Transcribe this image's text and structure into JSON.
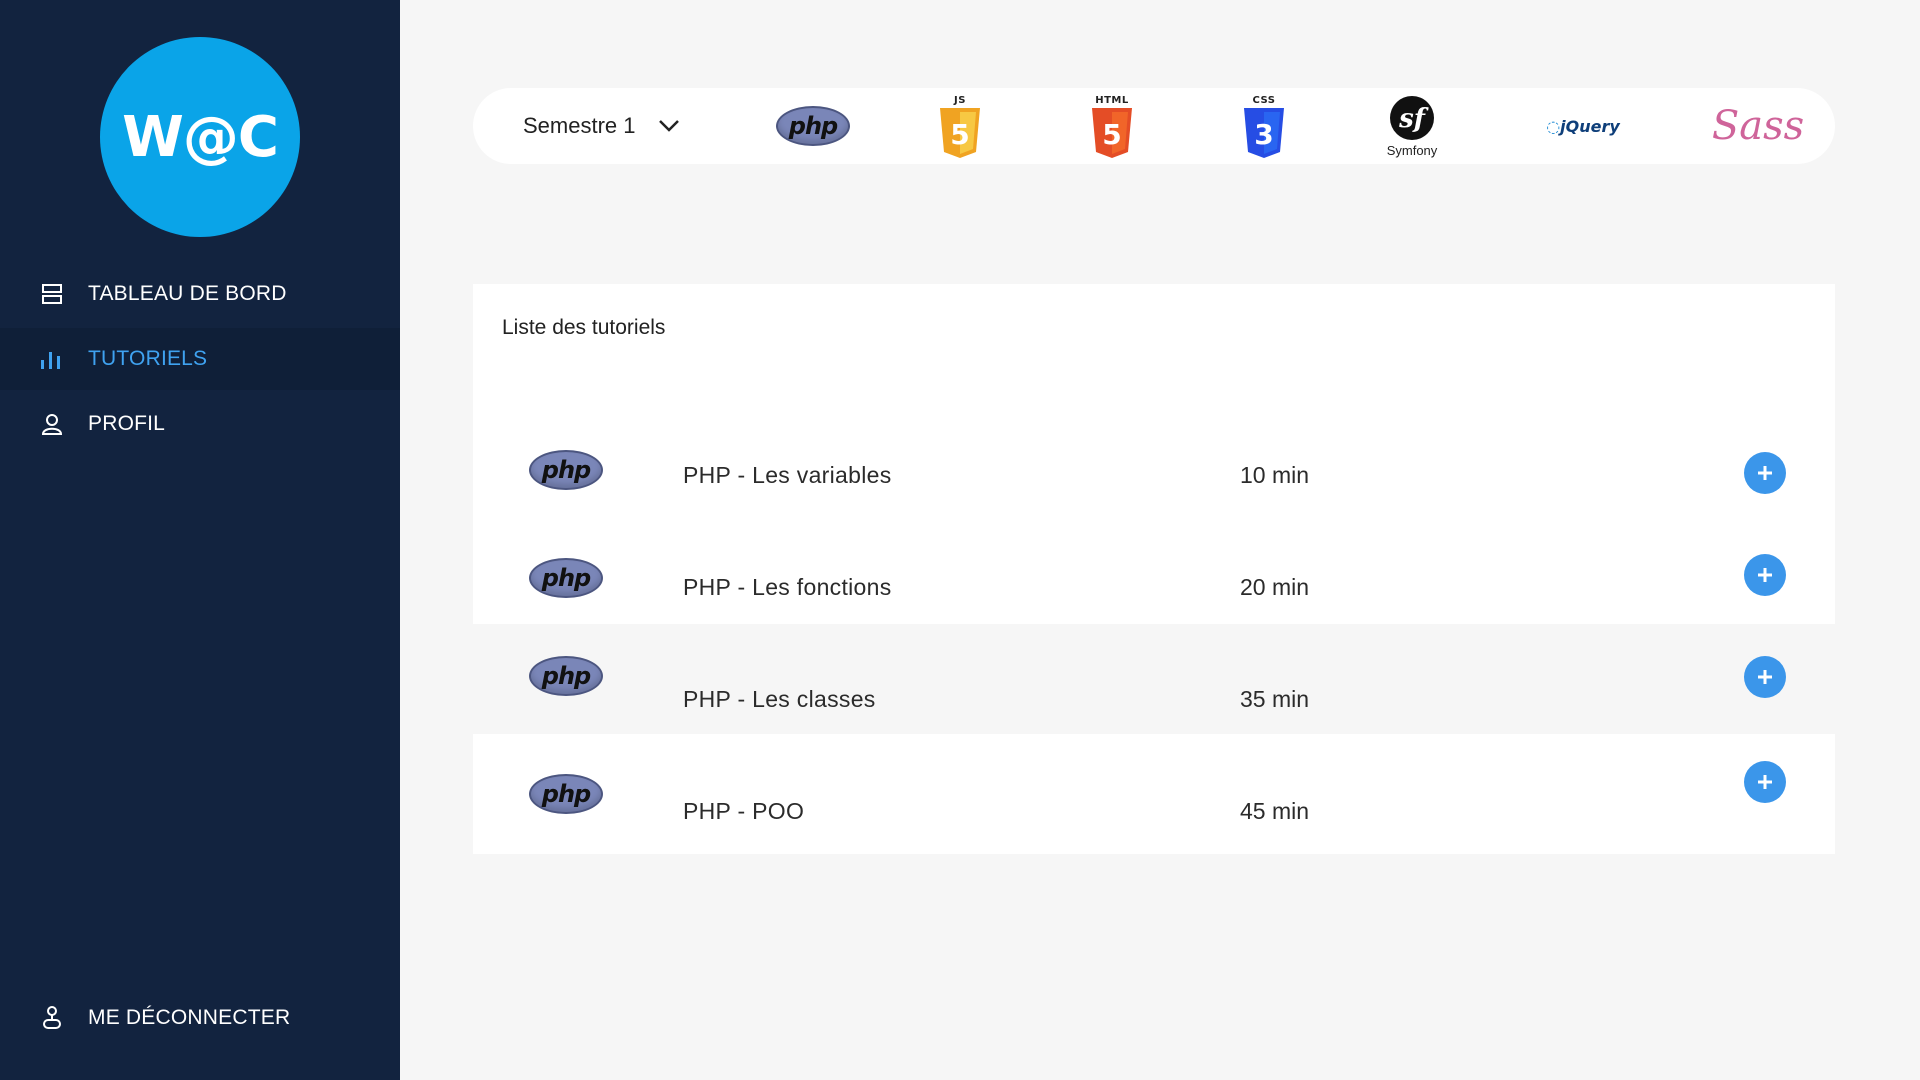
{
  "brand": {
    "logo_text": "W@C",
    "color": "#0aa4e8"
  },
  "sidebar": {
    "background": "#12233f",
    "items": [
      {
        "label": "TABLEAU DE BORD",
        "icon": "dashboard-icon",
        "active": false
      },
      {
        "label": "TUTORIELS",
        "icon": "bar-chart-icon",
        "active": true
      },
      {
        "label": "PROFIL",
        "icon": "user-icon",
        "active": false
      }
    ],
    "logout": {
      "label": "ME DÉCONNECTER",
      "icon": "logout-icon"
    }
  },
  "techbar": {
    "semester_selected": "Semestre 1",
    "technologies": [
      {
        "name": "php",
        "icon": "php-logo",
        "label": "php"
      },
      {
        "name": "js",
        "icon": "js-logo",
        "label": "JS"
      },
      {
        "name": "html",
        "icon": "html5-logo",
        "label": "HTML"
      },
      {
        "name": "css",
        "icon": "css3-logo",
        "label": "CSS"
      },
      {
        "name": "symfony",
        "icon": "symfony-logo",
        "label": "Symfony"
      },
      {
        "name": "jquery",
        "icon": "jquery-logo",
        "label": "jQuery"
      },
      {
        "name": "sass",
        "icon": "sass-logo",
        "label": "Sass"
      }
    ]
  },
  "panel": {
    "title": "Liste des tutoriels",
    "rows": [
      {
        "icon": "php-logo",
        "title": "PHP - Les variables",
        "duration": "10 min"
      },
      {
        "icon": "php-logo",
        "title": "PHP - Les fonctions",
        "duration": "20 min"
      },
      {
        "icon": "php-logo",
        "title": "PHP - Les classes",
        "duration": "35 min"
      },
      {
        "icon": "php-logo",
        "title": "PHP - POO",
        "duration": "45 min"
      }
    ]
  },
  "colors": {
    "accent": "#3b96ea",
    "active_nav": "#3fa2f0"
  }
}
